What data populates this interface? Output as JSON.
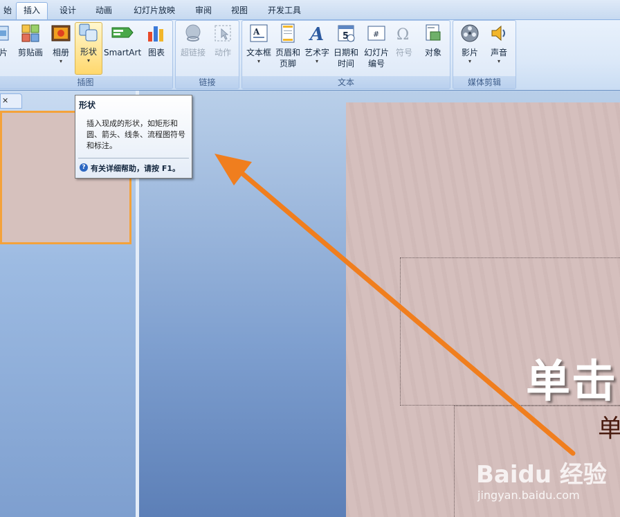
{
  "tabs": [
    {
      "label": "始"
    },
    {
      "label": "插入"
    },
    {
      "label": "设计"
    },
    {
      "label": "动画"
    },
    {
      "label": "幻灯片放映"
    },
    {
      "label": "审阅"
    },
    {
      "label": "视图"
    },
    {
      "label": "开发工具"
    }
  ],
  "ribbon": {
    "groups": {
      "illustrations": "插图",
      "links": "链接",
      "text": "文本",
      "media": "媒体剪辑"
    },
    "buttons": {
      "picture": "片",
      "clipart": "剪贴画",
      "album": "相册",
      "shapes": "形状",
      "smartart": "SmartArt",
      "chart": "图表",
      "hyperlink": "超链接",
      "action": "动作",
      "textbox": "文本框",
      "header_footer": [
        "页眉和",
        "页脚"
      ],
      "wordart": "艺术字",
      "datetime": [
        "日期和",
        "时间"
      ],
      "slide_number": [
        "幻灯片",
        "编号"
      ],
      "symbol": "符号",
      "object": "对象",
      "movie": "影片",
      "sound": "声音"
    }
  },
  "tooltip": {
    "title": "形状",
    "body": "插入现成的形状，如矩形和圆、箭头、线条、流程图符号和标注。",
    "help": "有关详细帮助，请按 F1。"
  },
  "slide": {
    "title": "单击",
    "subtitle": "单"
  },
  "watermark": {
    "logo": "Baidu 经验",
    "url": "jingyan.baidu.com"
  },
  "colors": {
    "ribbon": "#dbe8f8",
    "accent_arrow": "#f07e1e",
    "slide_bg": "#d5bfbd",
    "hot_button": "#ffd86d"
  }
}
